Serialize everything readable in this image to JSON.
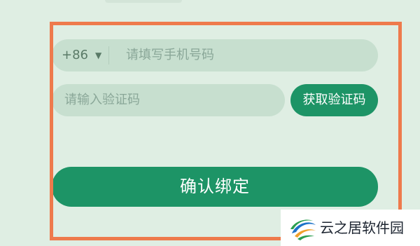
{
  "form": {
    "country_code": "+86",
    "country_code_arrow": "▼",
    "phone_placeholder": "请填写手机号码",
    "code_placeholder": "请输入验证码",
    "get_code_label": "获取验证码",
    "confirm_label": "确认绑定"
  },
  "watermark": {
    "text": "云之居软件园",
    "logo_icon": "swirl-logo-icon"
  },
  "colors": {
    "background": "#dfeee3",
    "field_background": "#c7dfcf",
    "primary_green": "#1d9466",
    "highlight_border": "#ee7a4c"
  }
}
